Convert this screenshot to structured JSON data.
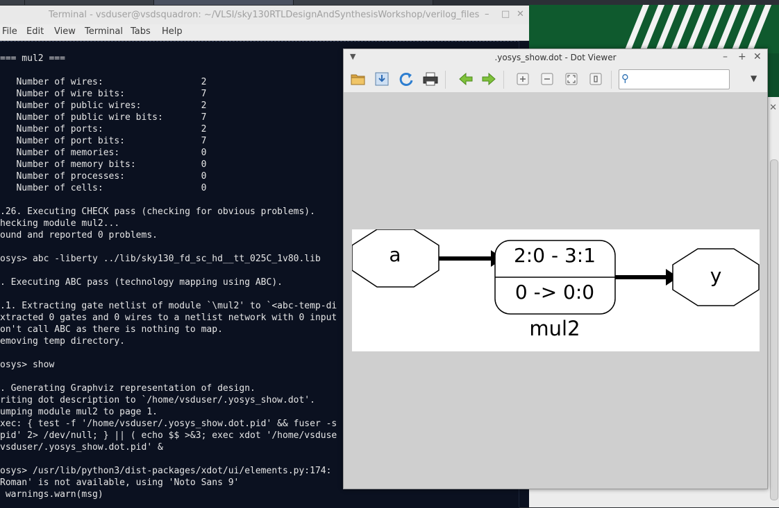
{
  "terminal": {
    "title": "Terminal - vsduser@vsdsquadron: ~/VLSI/sky130RTLDesignAndSynthesisWorkshop/verilog_files",
    "menu": [
      "File",
      "Edit",
      "View",
      "Terminal",
      "Tabs",
      "Help"
    ],
    "lines": [
      "=== mul2 ===",
      "",
      "   Number of wires:                  2",
      "   Number of wire bits:              7",
      "   Number of public wires:           2",
      "   Number of public wire bits:       7",
      "   Number of ports:                  2",
      "   Number of port bits:              7",
      "   Number of memories:               0",
      "   Number of memory bits:            0",
      "   Number of processes:              0",
      "   Number of cells:                  0",
      "",
      ".26. Executing CHECK pass (checking for obvious problems).",
      "hecking module mul2...",
      "ound and reported 0 problems.",
      "",
      "osys> abc -liberty ../lib/sky130_fd_sc_hd__tt_025C_1v80.lib",
      "",
      ". Executing ABC pass (technology mapping using ABC).",
      "",
      ".1. Extracting gate netlist of module `\\mul2' to `<abc-temp-di",
      "xtracted 0 gates and 0 wires to a netlist network with 0 input",
      "on't call ABC as there is nothing to map.",
      "emoving temp directory.",
      "",
      "osys> show",
      "",
      ". Generating Graphviz representation of design.",
      "riting dot description to `/home/vsduser/.yosys_show.dot'.",
      "umping module mul2 to page 1.",
      "xec: { test -f '/home/vsduser/.yosys_show.dot.pid' && fuser -s",
      "pid' 2> /dev/null; } || ( echo $$ >&3; exec xdot '/home/vsduse",
      "vsduser/.yosys_show.dot.pid' &",
      "",
      "osys> /usr/lib/python3/dist-packages/xdot/ui/elements.py:174:",
      "Roman' is not available, using 'Noto Sans 9'",
      " warnings.warn(msg)",
      ""
    ]
  },
  "dotviewer": {
    "title": ".yosys_show.dot - Dot Viewer",
    "tools": [
      "open-icon",
      "save-icon",
      "reload-icon",
      "print-icon",
      "back-icon",
      "forward-icon",
      "zoom-in-icon",
      "zoom-out-icon",
      "zoom-fit-icon",
      "zoom-100-icon"
    ],
    "search": {
      "value": "",
      "placeholder": ""
    },
    "graph": {
      "input_node": "a",
      "output_node": "y",
      "cell_top": "2:0 - 3:1",
      "cell_bottom": "0 -> 0:0",
      "module_label": "mul2"
    }
  }
}
